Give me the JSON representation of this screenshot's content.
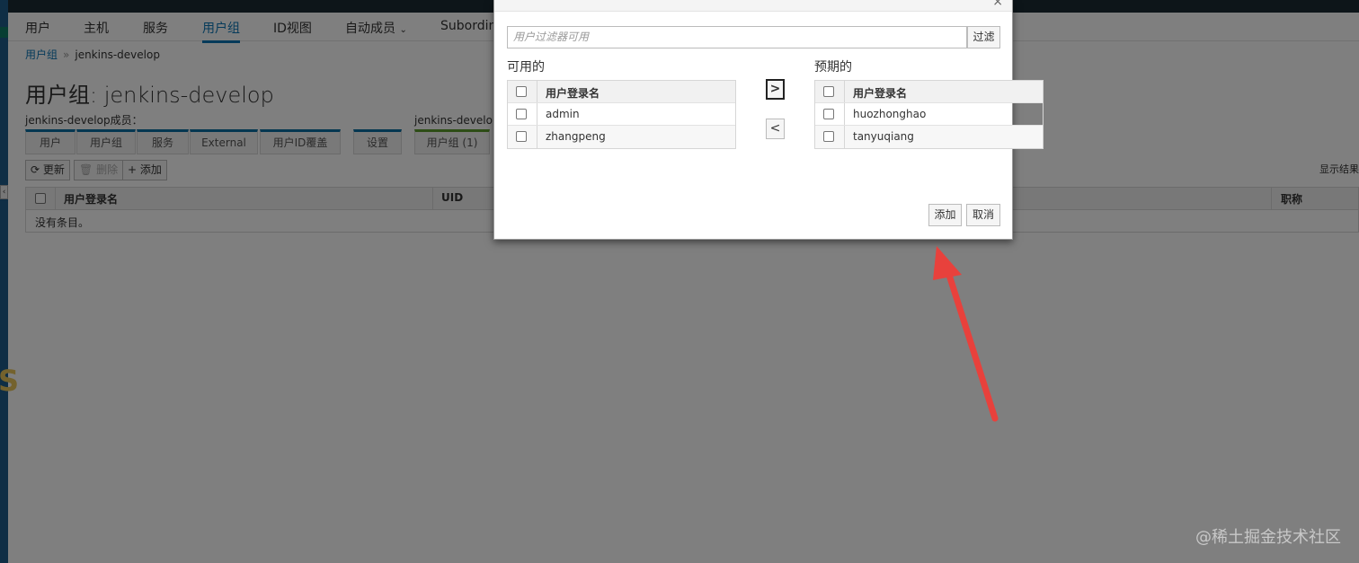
{
  "nav": {
    "items": [
      "用户",
      "主机",
      "服务",
      "用户组",
      "ID视图",
      "自动成员",
      "Subordin"
    ],
    "active_index": 3,
    "dropdown_index": 5
  },
  "breadcrumb": {
    "parent": "用户组",
    "sep": "»",
    "current": "jenkins-develop"
  },
  "page_title": "用户组: jenkins-develop",
  "members_label": "jenkins-develop成员：",
  "member_of_label": "jenkins-develop是",
  "facets_members": [
    "用户",
    "用户组",
    "服务",
    "External",
    "用户ID覆盖"
  ],
  "facets_other": [
    "设置",
    "用户组 (1)"
  ],
  "toolbar": {
    "refresh": "更新",
    "delete": "删除",
    "add": "添加"
  },
  "show_results": "显示结果",
  "table": {
    "columns": [
      "用户登录名",
      "UID",
      "职称"
    ],
    "empty_text": "没有条目。"
  },
  "dialog": {
    "filter_placeholder": "用户过滤器可用",
    "filter_button": "过滤",
    "available_title": "可用的",
    "selected_title": "预期的",
    "column_header": "用户登录名",
    "available_users": [
      "admin",
      "zhangpeng"
    ],
    "selected_users": [
      "huozhonghao",
      "tanyuqiang"
    ],
    "move_right": ">",
    "move_left": "<",
    "add_button": "添加",
    "cancel_button": "取消",
    "close": "×"
  },
  "watermark": "@稀土掘金技术社区",
  "colors": {
    "accent": "#0a75b5",
    "annotation_arrow": "#e8413c"
  },
  "icons": [
    "refresh-icon",
    "trash-icon",
    "plus-icon",
    "chevron-down-icon",
    "chevron-right-icon",
    "chevron-left-icon"
  ]
}
